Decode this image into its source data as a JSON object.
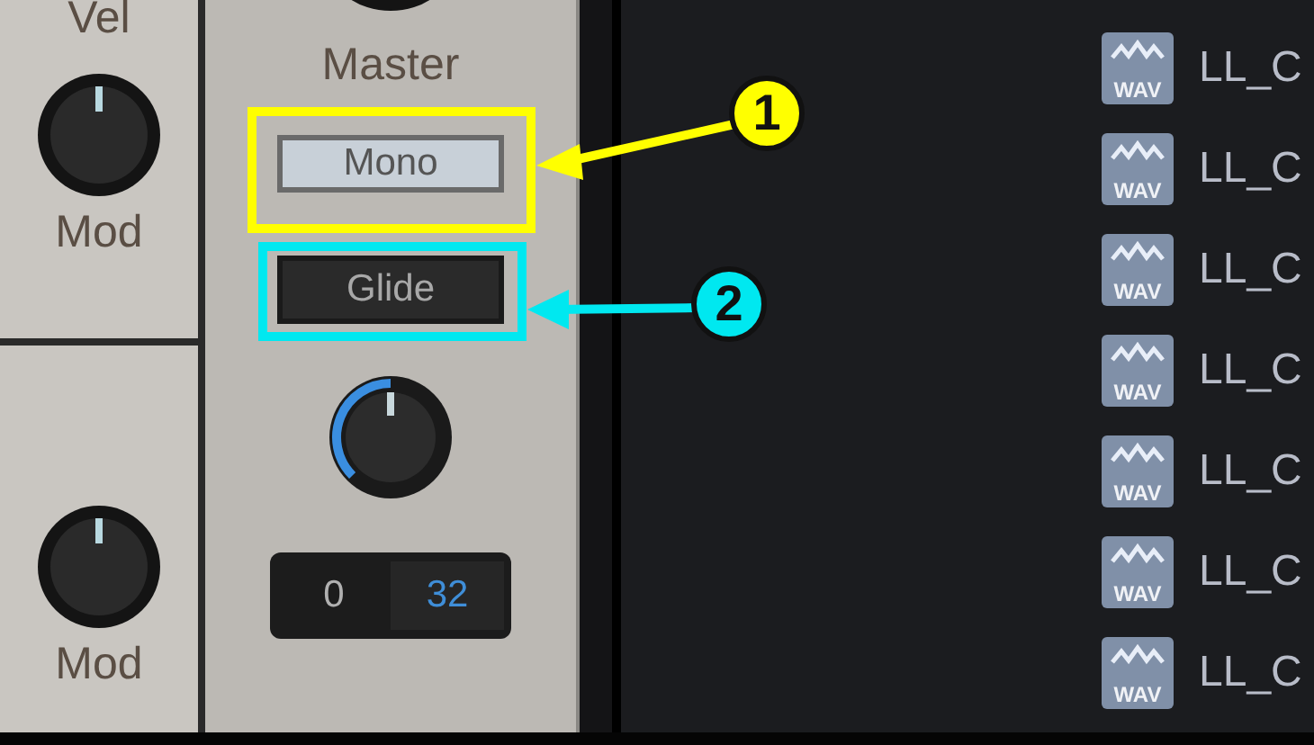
{
  "left_panel": {
    "sections": [
      {
        "top_label": "Vel",
        "knob_label": "Mod"
      },
      {
        "knob_label": "Mod"
      }
    ]
  },
  "master": {
    "label": "Master",
    "buttons": [
      {
        "label": "Mono",
        "on": true
      },
      {
        "label": "Glide",
        "on": false
      }
    ],
    "range": {
      "low": "0",
      "high": "32"
    }
  },
  "callouts": [
    {
      "number": "1",
      "color": "#ffff00"
    },
    {
      "number": "2",
      "color": "#00e8f0"
    }
  ],
  "files": [
    {
      "type": "WAV",
      "name": "LL_C"
    },
    {
      "type": "WAV",
      "name": "LL_C"
    },
    {
      "type": "WAV",
      "name": "LL_C"
    },
    {
      "type": "WAV",
      "name": "LL_C"
    },
    {
      "type": "WAV",
      "name": "LL_C"
    },
    {
      "type": "WAV",
      "name": "LL_C"
    },
    {
      "type": "WAV",
      "name": "LL_C"
    }
  ]
}
